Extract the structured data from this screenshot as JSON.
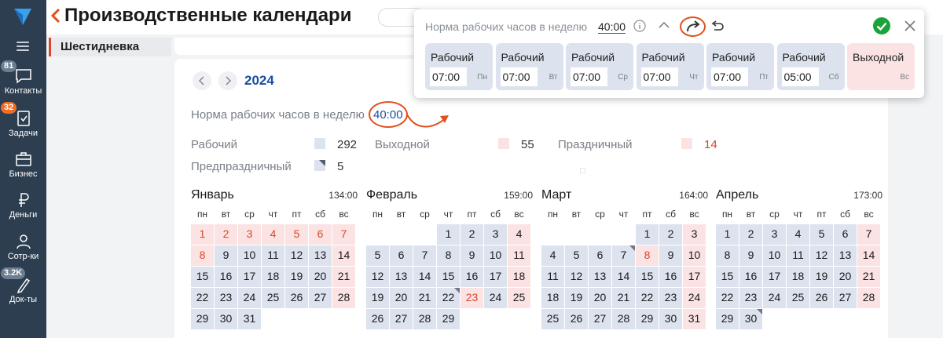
{
  "app": {
    "page_title": "Производственные календари"
  },
  "rail": {
    "items": [
      {
        "label": "Контакты",
        "badge": "81"
      },
      {
        "label": "Задачи",
        "badge": "32"
      },
      {
        "label": "Бизнес",
        "badge": ""
      },
      {
        "label": "Деньги",
        "badge": ""
      },
      {
        "label": "Сотр-ки",
        "badge": ""
      },
      {
        "label": "Док-ты",
        "badge": "3.2K"
      }
    ]
  },
  "list": {
    "active_item": "Шестидневка"
  },
  "calendar": {
    "year": "2024",
    "norm_label": "Норма рабочих часов в неделю",
    "norm_value": "40:00",
    "legend": [
      {
        "label": "Рабочий",
        "count": "292"
      },
      {
        "label": "Выходной",
        "count": "55"
      },
      {
        "label": "Праздничный",
        "count": "14"
      },
      {
        "label": "Предпраздничный",
        "count": "5"
      }
    ],
    "weekdays": [
      "пн",
      "вт",
      "ср",
      "чт",
      "пт",
      "сб",
      "вс"
    ],
    "months": [
      {
        "name": "Январь",
        "hours": "134:00",
        "offset": 0,
        "days": 31,
        "holidays": [
          1,
          2,
          3,
          4,
          5,
          6,
          7,
          8
        ],
        "off": [
          14,
          21,
          28
        ],
        "pre": []
      },
      {
        "name": "Февраль",
        "hours": "159:00",
        "offset": 3,
        "days": 29,
        "holidays": [
          23
        ],
        "off": [
          4,
          11,
          18,
          25
        ],
        "pre": [
          22
        ]
      },
      {
        "name": "Март",
        "hours": "164:00",
        "offset": 4,
        "days": 31,
        "holidays": [
          8
        ],
        "off": [
          3,
          10,
          17,
          24,
          31
        ],
        "pre": [
          7
        ]
      },
      {
        "name": "Апрель",
        "hours": "173:00",
        "offset": 0,
        "days": 30,
        "holidays": [],
        "off": [
          7,
          14,
          21,
          28
        ],
        "pre": [
          30
        ]
      }
    ]
  },
  "popup": {
    "norm_label": "Норма рабочих часов в неделю",
    "norm_value": "40:00",
    "days": [
      {
        "type": "Рабочий",
        "hours": "07:00",
        "short": "Пн",
        "off": false
      },
      {
        "type": "Рабочий",
        "hours": "07:00",
        "short": "Вт",
        "off": false
      },
      {
        "type": "Рабочий",
        "hours": "07:00",
        "short": "Ср",
        "off": false
      },
      {
        "type": "Рабочий",
        "hours": "07:00",
        "short": "Чт",
        "off": false
      },
      {
        "type": "Рабочий",
        "hours": "07:00",
        "short": "Пт",
        "off": false
      },
      {
        "type": "Рабочий",
        "hours": "05:00",
        "short": "Сб",
        "off": false
      },
      {
        "type": "Выходной",
        "hours": "",
        "short": "Вс",
        "off": true
      }
    ]
  },
  "colors": {
    "rail": "#2d3e50",
    "accent": "#e2501c",
    "holiday": "#d9482b",
    "link": "#1a4fa0",
    "work_cell": "#dde3ee",
    "off_cell": "#fbe3e3",
    "confirm": "#1aa33a"
  }
}
